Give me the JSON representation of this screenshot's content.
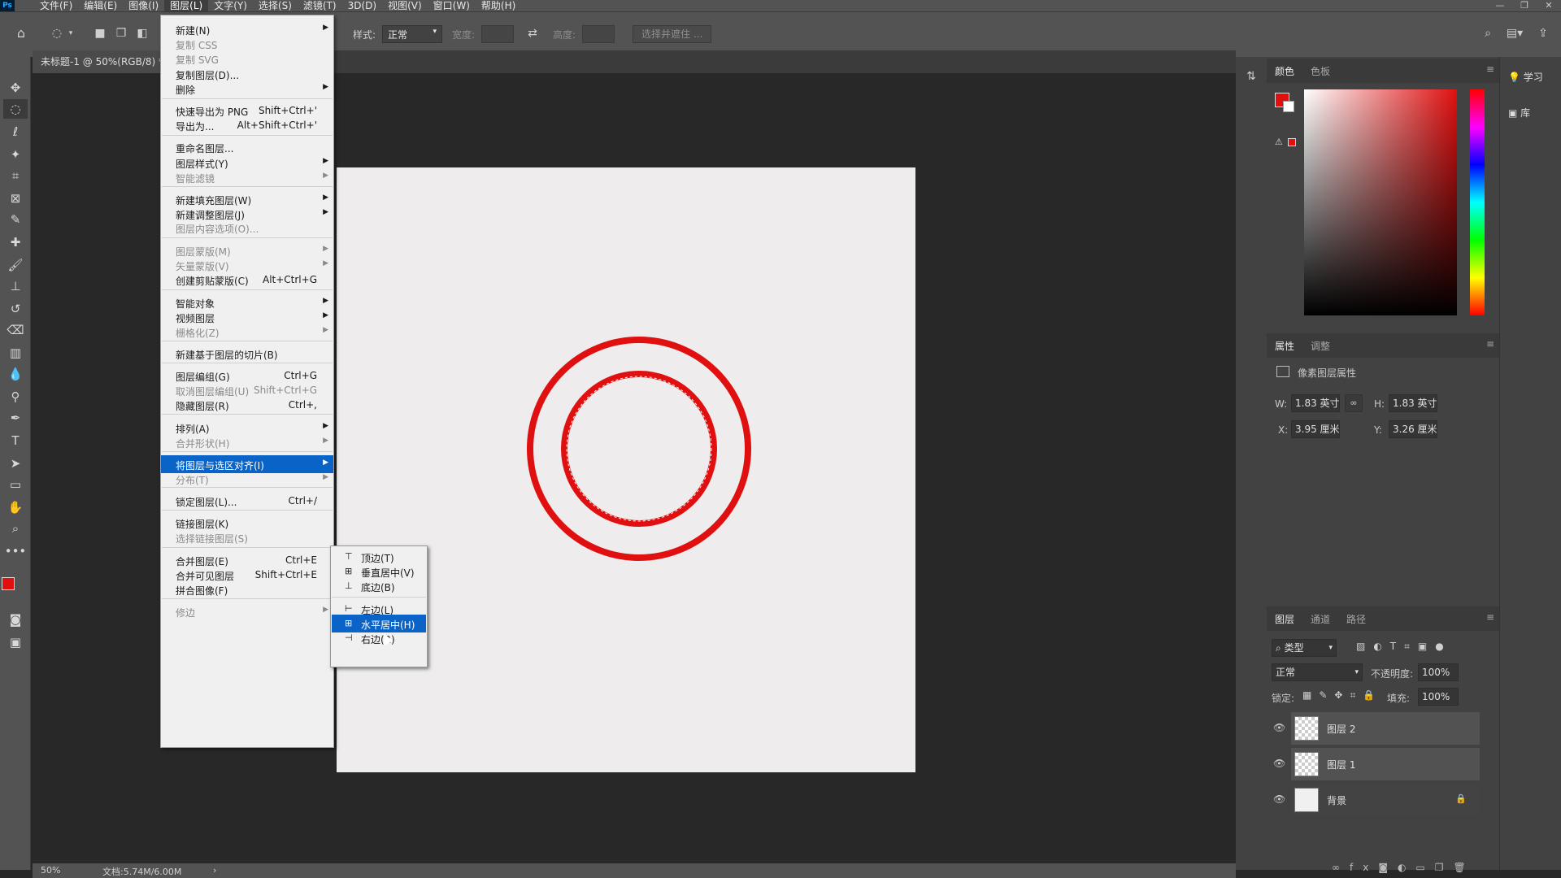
{
  "app": {
    "logo": "Ps"
  },
  "menubar": {
    "items": [
      "文件(F)",
      "编辑(E)",
      "图像(I)",
      "图层(L)",
      "文字(Y)",
      "选择(S)",
      "滤镜(T)",
      "3D(D)",
      "视图(V)",
      "窗口(W)",
      "帮助(H)"
    ],
    "active_index": 3
  },
  "window": {
    "minimize": "—",
    "restore": "❐",
    "close": "✕"
  },
  "options": {
    "style_label": "样式:",
    "style_value": "正常",
    "width_label": "宽度:",
    "height_label": "高度:",
    "select_mask_button": "选择并遮住 ..."
  },
  "document": {
    "tab_title": "未标题-1 @ 50%(RGB/8) *",
    "zoom": "50%",
    "doc_info": "文档:5.74M/6.00M",
    "status_arrow": "›"
  },
  "colors": {
    "accent_red": "#e01010",
    "menu_highlight": "#0a64c8",
    "canvas_bg": "#eeecec"
  },
  "layer_menu": {
    "items": [
      {
        "label": "新建(N)",
        "shortcut": "",
        "submenu": true,
        "disabled": false
      },
      {
        "label": "复制 CSS",
        "shortcut": "",
        "submenu": false,
        "disabled": true
      },
      {
        "label": "复制 SVG",
        "shortcut": "",
        "submenu": false,
        "disabled": true
      },
      {
        "label": "复制图层(D)...",
        "shortcut": "",
        "submenu": false,
        "disabled": false
      },
      {
        "label": "删除",
        "shortcut": "",
        "submenu": true,
        "disabled": false
      },
      {
        "label": "快速导出为 PNG",
        "shortcut": "Shift+Ctrl+'",
        "submenu": false,
        "disabled": false
      },
      {
        "label": "导出为...",
        "shortcut": "Alt+Shift+Ctrl+'",
        "submenu": false,
        "disabled": false
      },
      {
        "label": "重命名图层...",
        "shortcut": "",
        "submenu": false,
        "disabled": false
      },
      {
        "label": "图层样式(Y)",
        "shortcut": "",
        "submenu": true,
        "disabled": false
      },
      {
        "label": "智能滤镜",
        "shortcut": "",
        "submenu": true,
        "disabled": true
      },
      {
        "label": "新建填充图层(W)",
        "shortcut": "",
        "submenu": true,
        "disabled": false
      },
      {
        "label": "新建调整图层(J)",
        "shortcut": "",
        "submenu": true,
        "disabled": false
      },
      {
        "label": "图层内容选项(O)...",
        "shortcut": "",
        "submenu": false,
        "disabled": true
      },
      {
        "label": "图层蒙版(M)",
        "shortcut": "",
        "submenu": true,
        "disabled": true
      },
      {
        "label": "矢量蒙版(V)",
        "shortcut": "",
        "submenu": true,
        "disabled": true
      },
      {
        "label": "创建剪贴蒙版(C)",
        "shortcut": "Alt+Ctrl+G",
        "submenu": false,
        "disabled": false
      },
      {
        "label": "智能对象",
        "shortcut": "",
        "submenu": true,
        "disabled": false
      },
      {
        "label": "视频图层",
        "shortcut": "",
        "submenu": true,
        "disabled": false
      },
      {
        "label": "栅格化(Z)",
        "shortcut": "",
        "submenu": true,
        "disabled": true
      },
      {
        "label": "新建基于图层的切片(B)",
        "shortcut": "",
        "submenu": false,
        "disabled": false
      },
      {
        "label": "图层编组(G)",
        "shortcut": "Ctrl+G",
        "submenu": false,
        "disabled": false
      },
      {
        "label": "取消图层编组(U)",
        "shortcut": "Shift+Ctrl+G",
        "submenu": false,
        "disabled": true
      },
      {
        "label": "隐藏图层(R)",
        "shortcut": "Ctrl+,",
        "submenu": false,
        "disabled": false
      },
      {
        "label": "排列(A)",
        "shortcut": "",
        "submenu": true,
        "disabled": false
      },
      {
        "label": "合并形状(H)",
        "shortcut": "",
        "submenu": true,
        "disabled": true
      },
      {
        "label": "将图层与选区对齐(I)",
        "shortcut": "",
        "submenu": true,
        "disabled": false,
        "highlighted": true
      },
      {
        "label": "分布(T)",
        "shortcut": "",
        "submenu": true,
        "disabled": true
      },
      {
        "label": "锁定图层(L)...",
        "shortcut": "Ctrl+/",
        "submenu": false,
        "disabled": false
      },
      {
        "label": "链接图层(K)",
        "shortcut": "",
        "submenu": false,
        "disabled": false
      },
      {
        "label": "选择链接图层(S)",
        "shortcut": "",
        "submenu": false,
        "disabled": true
      },
      {
        "label": "合并图层(E)",
        "shortcut": "Ctrl+E",
        "submenu": false,
        "disabled": false
      },
      {
        "label": "合并可见图层",
        "shortcut": "Shift+Ctrl+E",
        "submenu": false,
        "disabled": false
      },
      {
        "label": "拼合图像(F)",
        "shortcut": "",
        "submenu": false,
        "disabled": false
      },
      {
        "label": "修边",
        "shortcut": "",
        "submenu": true,
        "disabled": true
      }
    ]
  },
  "align_submenu": {
    "items": [
      {
        "label": "顶边(T)",
        "icon": "align-top-icon"
      },
      {
        "label": "垂直居中(V)",
        "icon": "align-vcenter-icon"
      },
      {
        "label": "底边(B)",
        "icon": "align-bottom-icon"
      },
      {
        "label": "左边(L)",
        "icon": "align-left-icon"
      },
      {
        "label": "水平居中(H)",
        "icon": "align-hcenter-icon",
        "highlighted": true
      },
      {
        "label": "右边(R)",
        "icon": "align-right-icon"
      }
    ]
  },
  "color_panel": {
    "tabs": [
      "颜色",
      "色板"
    ]
  },
  "properties_panel": {
    "tabs": [
      "属性",
      "调整"
    ],
    "title": "像素图层属性",
    "w_label": "W:",
    "w_value": "1.83 英寸",
    "h_label": "H:",
    "h_value": "1.83 英寸",
    "x_label": "X:",
    "x_value": "3.95 厘米",
    "y_label": "Y:",
    "y_value": "3.26 厘米"
  },
  "side_buttons": {
    "learn": "学习",
    "library": "库"
  },
  "layers_panel": {
    "tabs": [
      "图层",
      "通道",
      "路径"
    ],
    "filter_label": "类型",
    "blend_mode": "正常",
    "opacity_label": "不透明度:",
    "opacity_value": "100%",
    "lock_label": "锁定:",
    "fill_label": "填充:",
    "fill_value": "100%",
    "layers": [
      {
        "name": "图层 2",
        "type": "pixel"
      },
      {
        "name": "图层 1",
        "type": "pixel"
      },
      {
        "name": "背景",
        "type": "background"
      }
    ]
  }
}
